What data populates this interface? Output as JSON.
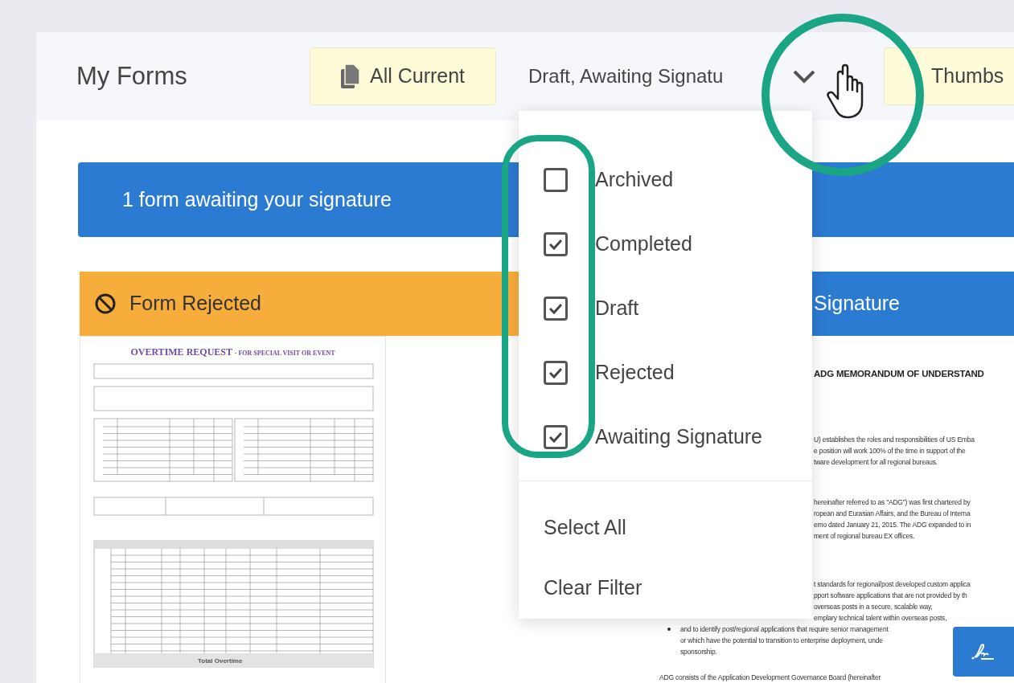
{
  "header": {
    "title": "My Forms",
    "view_button": "All Current",
    "filter_text": "Draft, Awaiting Signatu",
    "layout_button": "Thumbs"
  },
  "banner": "1 form awaiting your signature",
  "cards": [
    {
      "kind": "rejected",
      "title": "Form Rejected",
      "document": {
        "kind": "form",
        "title": "OVERTIME REQUEST",
        "subtitle": "- FOR SPECIAL VISIT OR EVENT",
        "footer": "Total Overtime"
      }
    },
    {
      "kind": "awaiting",
      "title": "Signature",
      "document": {
        "kind": "memo",
        "heading": "ADG MEMORANDUM OF UNDERSTAND",
        "sections": [
          [
            "U) establishes the roles and responsibilities of US Emba",
            "e position will work 100% of the time in support of the",
            "tware development for all regional bureaus."
          ],
          [
            "hereinafter referred to as \"ADG\") was first chartered by",
            "ropean and Eurasian Affairs, and the Bureau of Interna",
            "emo dated January 21, 2015.  The ADG expanded to in",
            "ment of regional bureau EX offices."
          ],
          [
            "t standards for regional/post developed custom applica",
            "pport software applications that are not provided by th",
            "overseas posts in a secure, scalable way,",
            "emplary technical talent within overseas posts,"
          ]
        ],
        "bullet": [
          "and to identify post/regional applications that require senior management",
          "or which have the potential to transition to enterprise deployment, unde",
          "sponsorship."
        ],
        "closing": "ADG consists of the Application Development Governance Board (hereinafter"
      }
    }
  ],
  "filter_menu": {
    "options": [
      {
        "label": "Archived",
        "checked": false
      },
      {
        "label": "Completed",
        "checked": true
      },
      {
        "label": "Draft",
        "checked": true
      },
      {
        "label": "Rejected",
        "checked": true
      },
      {
        "label": "Awaiting Signature",
        "checked": true
      }
    ],
    "actions": [
      "Select All",
      "Clear Filter"
    ]
  }
}
